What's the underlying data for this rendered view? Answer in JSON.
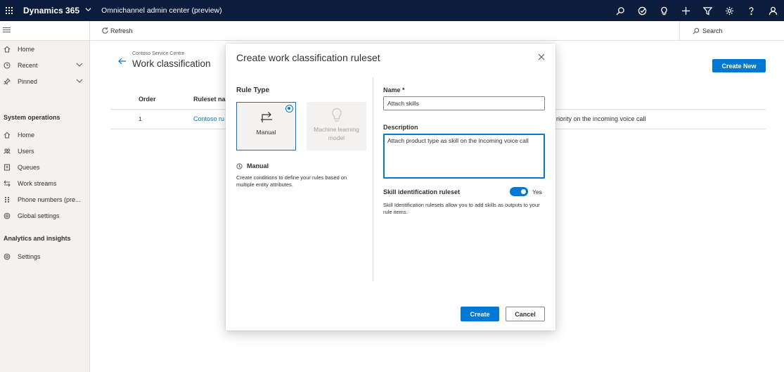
{
  "topbar": {
    "brand": "Dynamics 365",
    "app_name": "Omnichannel admin center (preview)",
    "icons": [
      "search-icon",
      "task-icon",
      "lightbulb-icon",
      "plus-icon",
      "filter-icon",
      "gear-icon",
      "help-icon",
      "user-icon"
    ],
    "background": "#0b1c3d"
  },
  "commandbar": {
    "refresh_label": "Refresh",
    "search_label": "Search"
  },
  "sidebar": {
    "top_items": [
      {
        "label": "Home",
        "icon": "home-icon"
      },
      {
        "label": "Recent",
        "icon": "clock-icon"
      },
      {
        "label": "Pinned",
        "icon": "pin-icon"
      }
    ],
    "section_system": "System operations",
    "system_items": [
      {
        "label": "Home",
        "icon": "home-icon"
      },
      {
        "label": "Users",
        "icon": "users-icon"
      },
      {
        "label": "Queues",
        "icon": "queue-icon"
      },
      {
        "label": "Work streams",
        "icon": "workstream-icon"
      },
      {
        "label": "Phone numbers (pre...",
        "icon": "phone-grid-icon"
      },
      {
        "label": "Global settings",
        "icon": "gear-icon"
      }
    ],
    "section_analytics": "Analytics and insights",
    "analytics_items": [
      {
        "label": "Settings",
        "icon": "gear-icon"
      }
    ]
  },
  "page": {
    "breadcrumb": "Contoso Service Centre",
    "title": "Work classification",
    "create_new_label": "Create New",
    "table": {
      "headers": [
        "Order",
        "Ruleset na"
      ],
      "rows": [
        {
          "order": "1",
          "ruleset": "Contoso ru",
          "description": "riority on the incoming voice call"
        }
      ]
    }
  },
  "dialog": {
    "title": "Create work classification ruleset",
    "rule_type_heading": "Rule Type",
    "options": [
      {
        "label": "Manual",
        "icon": "manual-route-icon",
        "selected": true,
        "enabled": true
      },
      {
        "label": "Machine learning model",
        "icon": "lightbulb-icon",
        "selected": false,
        "enabled": false
      }
    ],
    "selected_heading": "Manual",
    "selected_description": "Create conditions to define your rules based on multiple entity attributes.",
    "name_label": "Name *",
    "name_value": "Attach skills",
    "description_label": "Description",
    "description_value": "Attach product type as skill on the incoming voice call",
    "skill_label": "Skill identification ruleset",
    "skill_enabled": true,
    "skill_state": "Yes",
    "skill_help": "Skill Identification rulesets allow you to add skills as outputs to your rule items.",
    "create_label": "Create",
    "cancel_label": "Cancel",
    "accent": "#0078d4"
  }
}
